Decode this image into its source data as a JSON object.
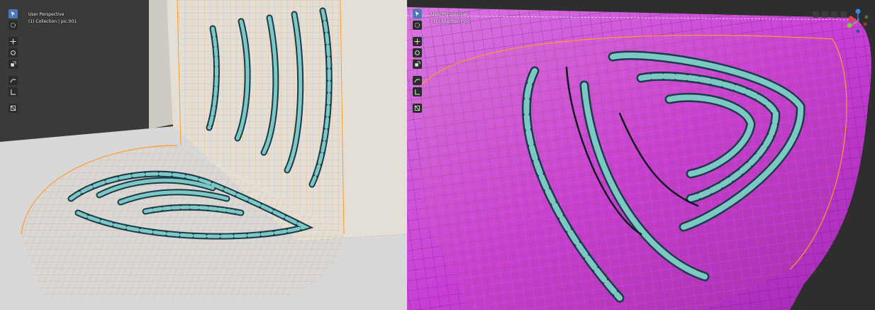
{
  "left_viewport": {
    "view_name": "User Perspective",
    "collection": "(1) Collection | pic.001"
  },
  "right_viewport": {
    "view_name": "User Perspective",
    "collection": "(1) Collection | pic"
  },
  "toolbar": {
    "tools": [
      "select-box-icon",
      "cursor-icon",
      "move-icon",
      "rotate-icon",
      "scale-icon",
      "annotate-icon",
      "measure-icon",
      "add-cube-icon"
    ]
  },
  "colors": {
    "wall": "#e3dfd7",
    "floor": "#dadada",
    "background": "#3a3a3a",
    "mesh_wire": "#e5a04a",
    "mesh_outline": "#ff9a2b",
    "pattern_fill": "#7cc8c4",
    "pattern_edge": "#1c3a4a",
    "magenta_surface": "#c93fd6",
    "active_tool": "#4d78b5",
    "gizmo_x": "#e0443a",
    "gizmo_y": "#83c43a",
    "gizmo_z": "#3d87e3"
  },
  "gizmo": {
    "axes": [
      "x",
      "y",
      "z"
    ]
  }
}
